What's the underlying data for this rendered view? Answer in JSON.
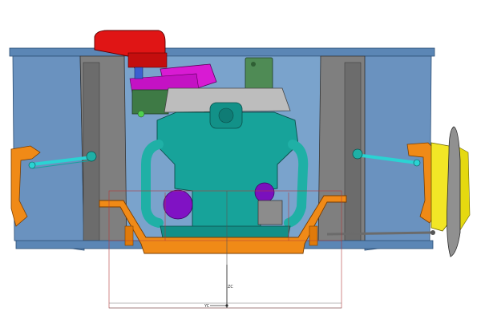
{
  "axes": {
    "vertical_label": "ZC",
    "horizontal_label": "YC"
  }
}
